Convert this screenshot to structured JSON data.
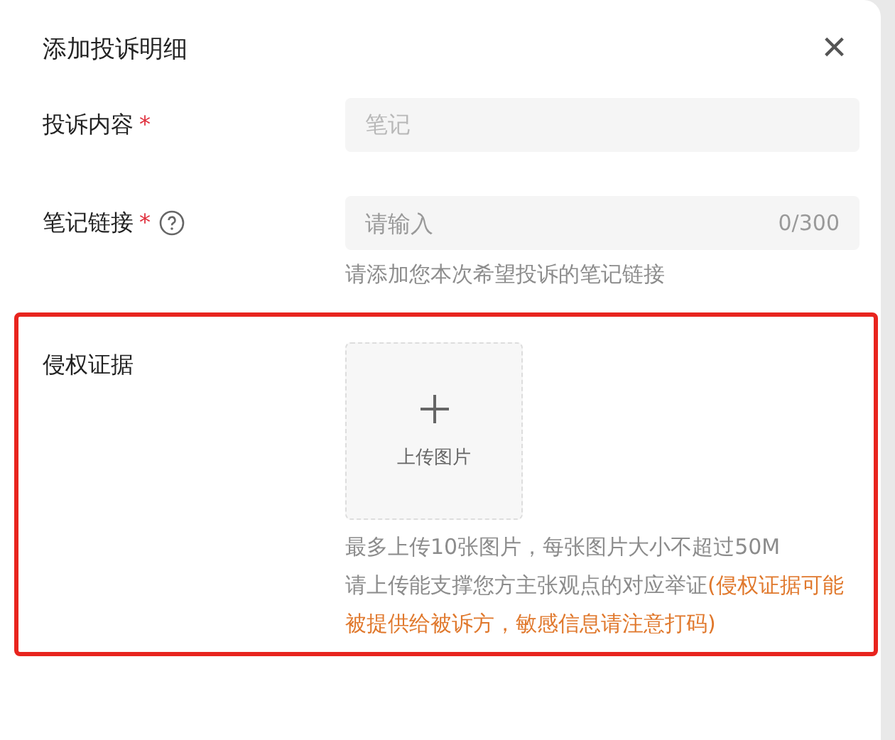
{
  "dialog": {
    "title": "添加投诉明细",
    "close": "×"
  },
  "fields": [
    {
      "kind": "readonly",
      "label": "投诉内容",
      "required_mark": "*",
      "placeholder": "笔记"
    },
    {
      "kind": "text",
      "label": "笔记链接",
      "required_mark": "*",
      "help": true,
      "placeholder": "请输入",
      "counter": "0/300",
      "hint": "请添加您本次希望投诉的笔记链接"
    },
    {
      "kind": "upload",
      "label": "侵权证据",
      "highlighted": true,
      "upload_label": "上传图片",
      "hint_lines": [
        "最多上传10张图片，每张图片大小不超过50M"
      ],
      "hint_text": "请上传能支撑您方主张观点的对应举证",
      "warning": "(侵权证据可能被提供给被诉方，敏感信息请注意打码)"
    }
  ]
}
